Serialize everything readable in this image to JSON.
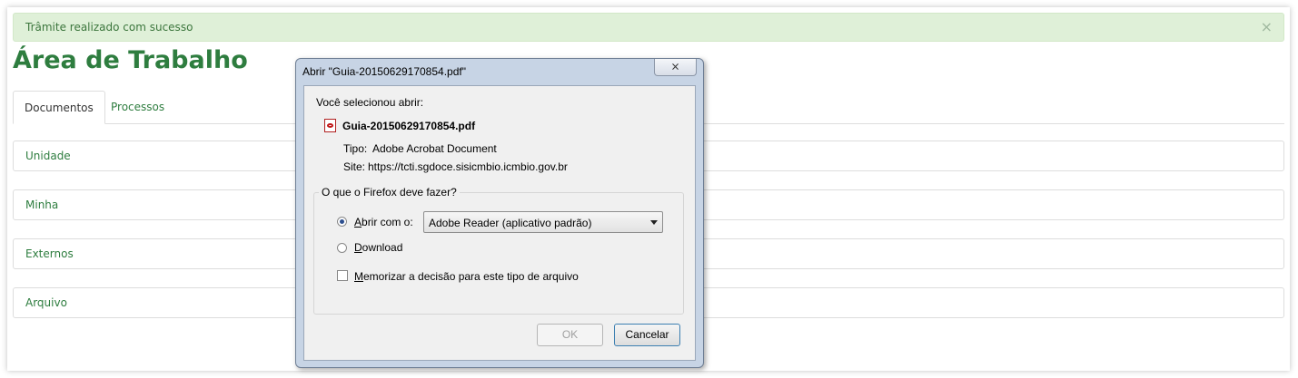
{
  "alert": {
    "message": "Trâmite realizado com sucesso",
    "close": "×"
  },
  "page": {
    "title": "Área de Trabalho"
  },
  "tabs": [
    {
      "label": "Documentos",
      "active": true
    },
    {
      "label": "Processos",
      "active": false
    }
  ],
  "panels": [
    "Unidade",
    "Minha",
    "Externos",
    "Arquivo"
  ],
  "dialog": {
    "title": "Abrir \"Guia-20150629170854.pdf\"",
    "close": "⨯",
    "selected_text": "Você selecionou abrir:",
    "file_name": "Guia-20150629170854.pdf",
    "file_icon": "pdf-file-icon",
    "type_label": "Tipo:",
    "type_value": "Adobe Acrobat Document",
    "site_label": "Site:",
    "site_value": "https://tcti.sgdoce.sisicmbio.icmbio.gov.br",
    "group_label": "O que o Firefox deve fazer?",
    "open_with_accel": "A",
    "open_with_rest": "brir com o:",
    "open_with_value": "Adobe Reader  (aplicativo padrão)",
    "download_accel": "D",
    "download_rest": "ownload",
    "remember_accel": "M",
    "remember_rest": "emorizar a decisão para este tipo de arquivo",
    "ok": "OK",
    "cancel": "Cancelar"
  },
  "colors": {
    "accent": "#2e7d3f",
    "alert_bg": "#dff0d8",
    "dialog_frame": "#c7d4e5"
  }
}
